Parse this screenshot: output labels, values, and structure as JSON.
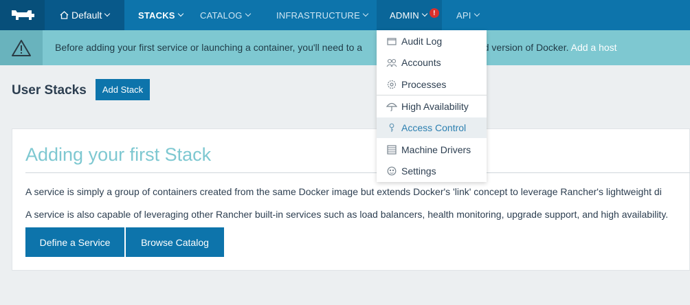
{
  "nav": {
    "environment": "Default",
    "items": [
      {
        "label": "STACKS",
        "active": true
      },
      {
        "label": "CATALOG",
        "active": false
      },
      {
        "label": "INFRASTRUCTURE",
        "active": false
      },
      {
        "label": "ADMIN",
        "active": false,
        "alert": "!"
      },
      {
        "label": "API",
        "active": false
      }
    ]
  },
  "banner": {
    "text_before": "Before adding your first service or launching a container, you'll need to a",
    "text_after": "pported version of Docker.",
    "link": "Add a host"
  },
  "page": {
    "title": "User Stacks",
    "add_button": "Add Stack"
  },
  "card": {
    "title": "Adding your first Stack",
    "p1": "A service is simply a group of containers created from the same Docker image but extends Docker's 'link' concept to leverage Rancher's lightweight di",
    "p2": "A service is also capable of leveraging other Rancher built-in services such as load balancers, health monitoring, upgrade support, and high availability.",
    "define_button": "Define a Service",
    "browse_button": "Browse Catalog"
  },
  "admin_menu": {
    "items": [
      {
        "label": "Audit Log",
        "icon": "audit-log-icon"
      },
      {
        "label": "Accounts",
        "icon": "accounts-icon"
      },
      {
        "label": "Processes",
        "icon": "processes-icon"
      },
      {
        "label": "High Availability",
        "icon": "umbrella-icon"
      },
      {
        "label": "Access Control",
        "icon": "key-icon",
        "active": true
      },
      {
        "label": "Machine Drivers",
        "icon": "machine-drivers-icon"
      },
      {
        "label": "Settings",
        "icon": "settings-icon"
      }
    ]
  },
  "colors": {
    "nav": "#0d74ab",
    "banner": "#7ec8d1",
    "alert": "#d9302d",
    "accent_title": "#7ec8d1"
  }
}
